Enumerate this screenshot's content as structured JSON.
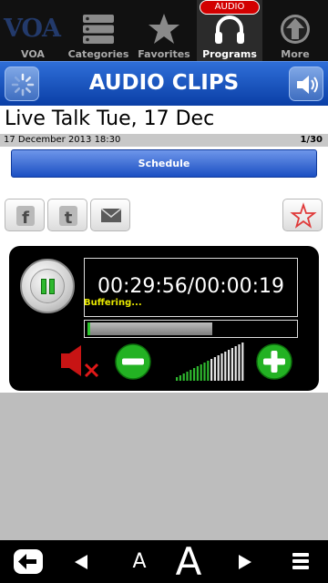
{
  "tabs": [
    {
      "label": "VOA",
      "icon": "voa-logo-icon",
      "logo_text": "VOA"
    },
    {
      "label": "Categories",
      "icon": "list-icon"
    },
    {
      "label": "Favorites",
      "icon": "star-icon"
    },
    {
      "label": "Programs",
      "icon": "headphones-icon",
      "active": true
    },
    {
      "label": "More",
      "icon": "arrow-up-circle-icon"
    }
  ],
  "programs_badge": "AUDIO",
  "titlebar": {
    "title": "AUDIO CLIPS",
    "left_icon": "loading-spinner-icon",
    "right_icon": "speaker-icon"
  },
  "article": {
    "headline": "Live Talk Tue, 17 Dec",
    "date": "17 December 2013 18:30",
    "pager": "1/30"
  },
  "schedule_label": "Schedule",
  "share": {
    "facebook": "f",
    "twitter": "t"
  },
  "player": {
    "time": "00:29:56/00:00:19",
    "status": "Buffering...",
    "progress": 0.6,
    "volume_level": 0.5
  },
  "bottom": {
    "back_icon": "back-arrow-icon",
    "prev_icon": "left-triangle-icon",
    "font_small": "A",
    "font_large": "A",
    "next_icon": "right-triangle-icon",
    "menu_icon": "menu-icon"
  },
  "colors": {
    "accent_blue": "#1b4fc2",
    "active_green": "#2fb82f",
    "badge_red": "#d20000",
    "status_yellow": "#e8e800"
  }
}
